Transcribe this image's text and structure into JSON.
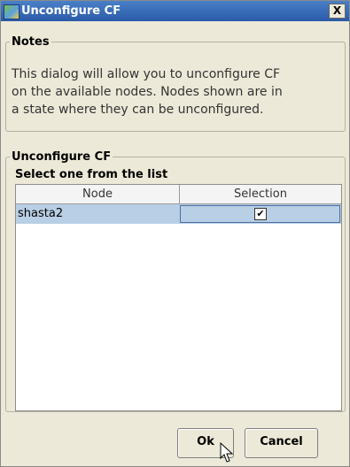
{
  "window": {
    "title": "Unconfigure CF",
    "close_label": "X"
  },
  "notes": {
    "legend": "Notes",
    "lines": [
      "This dialog will allow you to unconfigure CF",
      "on the available nodes.  Nodes shown are in",
      "a state where they can be unconfigured."
    ]
  },
  "unconfigure": {
    "legend": "Unconfigure CF",
    "select_label": "Select one from the list",
    "columns": [
      "Node",
      "Selection"
    ],
    "rows": [
      {
        "node": "shasta2",
        "selected": "✔"
      }
    ]
  },
  "buttons": {
    "ok": "Ok",
    "cancel": "Cancel"
  },
  "icons": {
    "app": "app-icon",
    "close": "close-icon",
    "cursor": "mouse-cursor-icon",
    "check": "checkmark-icon"
  }
}
